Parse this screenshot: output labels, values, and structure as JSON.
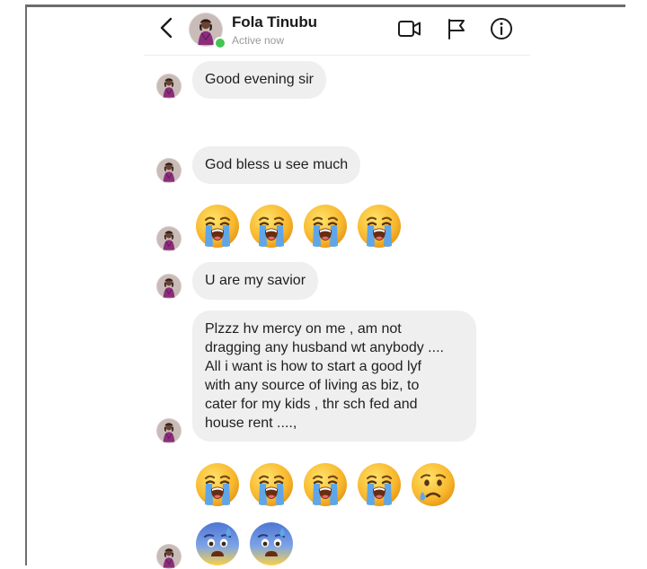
{
  "header": {
    "name": "Fola Tinubu",
    "status": "Active now",
    "actions": [
      "video-call-icon",
      "flag-icon",
      "info-icon"
    ]
  },
  "messages": [
    {
      "type": "text",
      "text": "Good evening sir"
    },
    {
      "type": "text",
      "text": "God bless u see much"
    },
    {
      "type": "emoji",
      "emojis": [
        "loudly-crying-face",
        "loudly-crying-face",
        "loudly-crying-face",
        "loudly-crying-face"
      ]
    },
    {
      "type": "text",
      "text": "U are my savior"
    },
    {
      "type": "text",
      "lines": [
        "Plzzz hv mercy on me , am not",
        "dragging any husband wt anybody ....",
        "All i want is how to start a good lyf",
        "with any source of living as biz, to",
        "cater for my kids , thr sch fed and",
        "house rent ....,"
      ]
    },
    {
      "type": "emoji",
      "emojis": [
        "loudly-crying-face",
        "loudly-crying-face",
        "loudly-crying-face",
        "loudly-crying-face",
        "crying-face"
      ]
    },
    {
      "type": "emoji",
      "emojis": [
        "anxious-face-with-sweat",
        "anxious-face-with-sweat"
      ]
    }
  ],
  "colors": {
    "bubble": "#efefef",
    "online": "#44c552",
    "avatar_dress": "#8b2d7a",
    "emoji_yellow": "#f7b529",
    "emoji_tear": "#5fa6e8",
    "anxious_blue": "#6a8fd6"
  }
}
